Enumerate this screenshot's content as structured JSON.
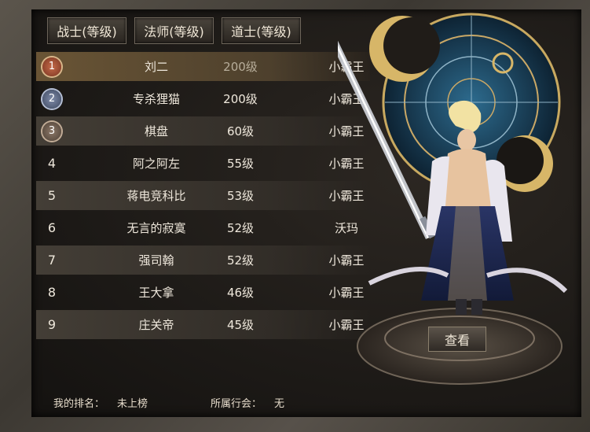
{
  "tabs": [
    {
      "label": "战士(等级)"
    },
    {
      "label": "法师(等级)"
    },
    {
      "label": "道士(等级)"
    }
  ],
  "ranking": [
    {
      "rank": "1",
      "name": "刘二",
      "level": "200级",
      "guild": "小霸王"
    },
    {
      "rank": "2",
      "name": "专杀狸猫",
      "level": "200级",
      "guild": "小霸王"
    },
    {
      "rank": "3",
      "name": "棋盘",
      "level": "60级",
      "guild": "小霸王"
    },
    {
      "rank": "4",
      "name": "阿之阿左",
      "level": "55级",
      "guild": "小霸王"
    },
    {
      "rank": "5",
      "name": "蒋电竞科比",
      "level": "53级",
      "guild": "小霸王"
    },
    {
      "rank": "6",
      "name": "无言的寂寞",
      "level": "52级",
      "guild": "沃玛"
    },
    {
      "rank": "7",
      "name": "强司翰",
      "level": "52级",
      "guild": "小霸王"
    },
    {
      "rank": "8",
      "name": "王大拿",
      "level": "46级",
      "guild": "小霸王"
    },
    {
      "rank": "9",
      "name": "庄关帝",
      "level": "45级",
      "guild": "小霸王"
    }
  ],
  "footer": {
    "my_rank_label": "我的排名：",
    "my_rank_value": "未上榜",
    "guild_label": "所属行会：",
    "guild_value": "无"
  },
  "view_button": "查看",
  "colors": {
    "gold": "#d8b66a",
    "blue_disc": "#1d4a6a",
    "text": "#efe8dc"
  }
}
